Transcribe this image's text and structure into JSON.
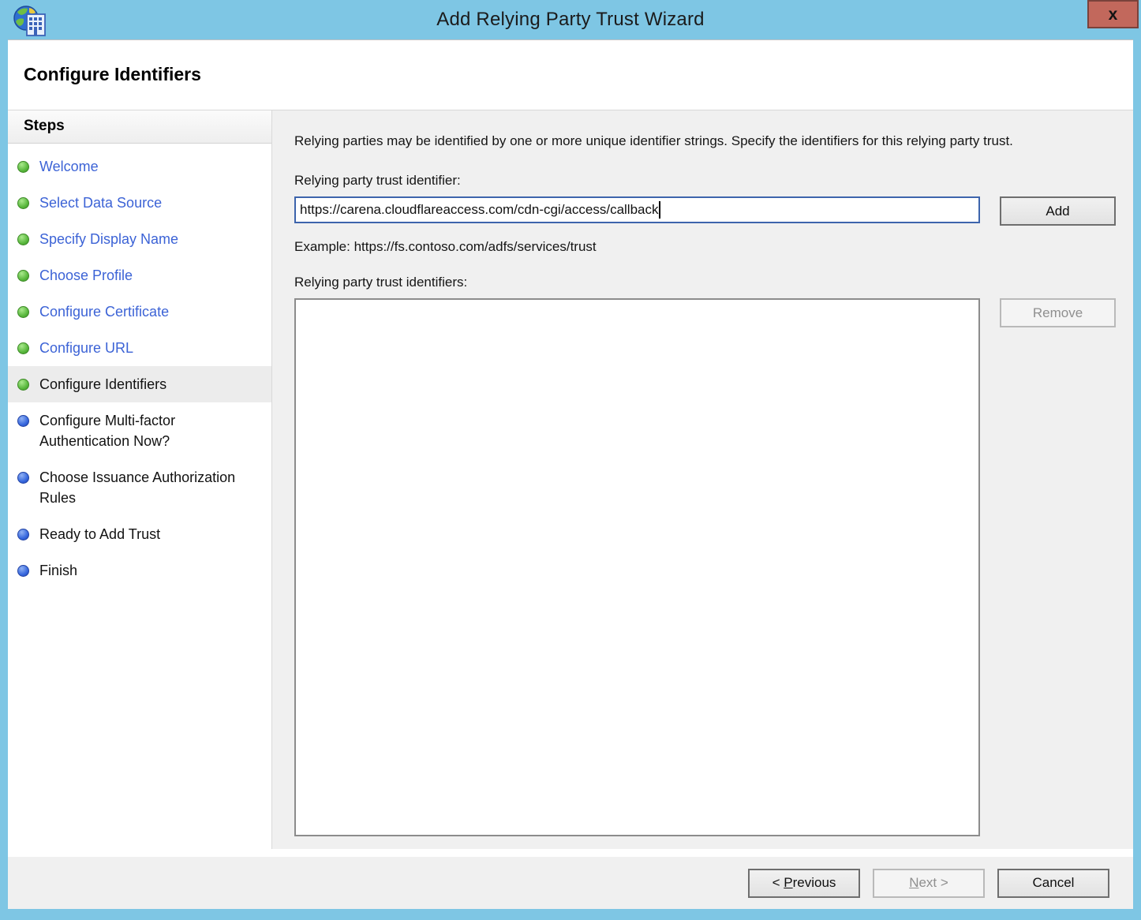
{
  "window": {
    "title": "Add Relying Party Trust Wizard",
    "close_glyph": "x",
    "app_icon": "adfs-globe-building-icon"
  },
  "page": {
    "heading": "Configure Identifiers"
  },
  "steps_panel": {
    "title": "Steps",
    "items": [
      {
        "label": "Welcome",
        "state": "done"
      },
      {
        "label": "Select Data Source",
        "state": "done"
      },
      {
        "label": "Specify Display Name",
        "state": "done"
      },
      {
        "label": "Choose Profile",
        "state": "done"
      },
      {
        "label": "Configure Certificate",
        "state": "done"
      },
      {
        "label": "Configure URL",
        "state": "done"
      },
      {
        "label": "Configure Identifiers",
        "state": "current"
      },
      {
        "label": "Configure Multi-factor Authentication Now?",
        "state": "upcoming"
      },
      {
        "label": "Choose Issuance Authorization Rules",
        "state": "upcoming"
      },
      {
        "label": "Ready to Add Trust",
        "state": "upcoming"
      },
      {
        "label": "Finish",
        "state": "upcoming"
      }
    ]
  },
  "content": {
    "description": "Relying parties may be identified by one or more unique identifier strings. Specify the identifiers for this relying party trust.",
    "identifier_label": "Relying party trust identifier:",
    "identifier_value": "https://carena.cloudflareaccess.com/cdn-cgi/access/callback",
    "add_button_label": "Add",
    "example_text": "Example: https://fs.contoso.com/adfs/services/trust",
    "identifiers_list_label": "Relying party trust identifiers:",
    "identifiers_list_items": [],
    "remove_button_label": "Remove"
  },
  "footer": {
    "previous_button": {
      "pre": "< ",
      "accel": "P",
      "post": "revious"
    },
    "next_button": {
      "pre": "",
      "accel": "N",
      "post": "ext >"
    },
    "cancel_button_label": "Cancel"
  },
  "colors": {
    "titlebar_blue": "#7EC6E4",
    "close_button_red": "#C2685C",
    "link_blue": "#3C63D6",
    "step_done_green": "#58B73C",
    "step_upcoming_blue": "#3566DD",
    "content_gray": "#F0F0F0",
    "focused_input_border": "#3D64AC"
  }
}
